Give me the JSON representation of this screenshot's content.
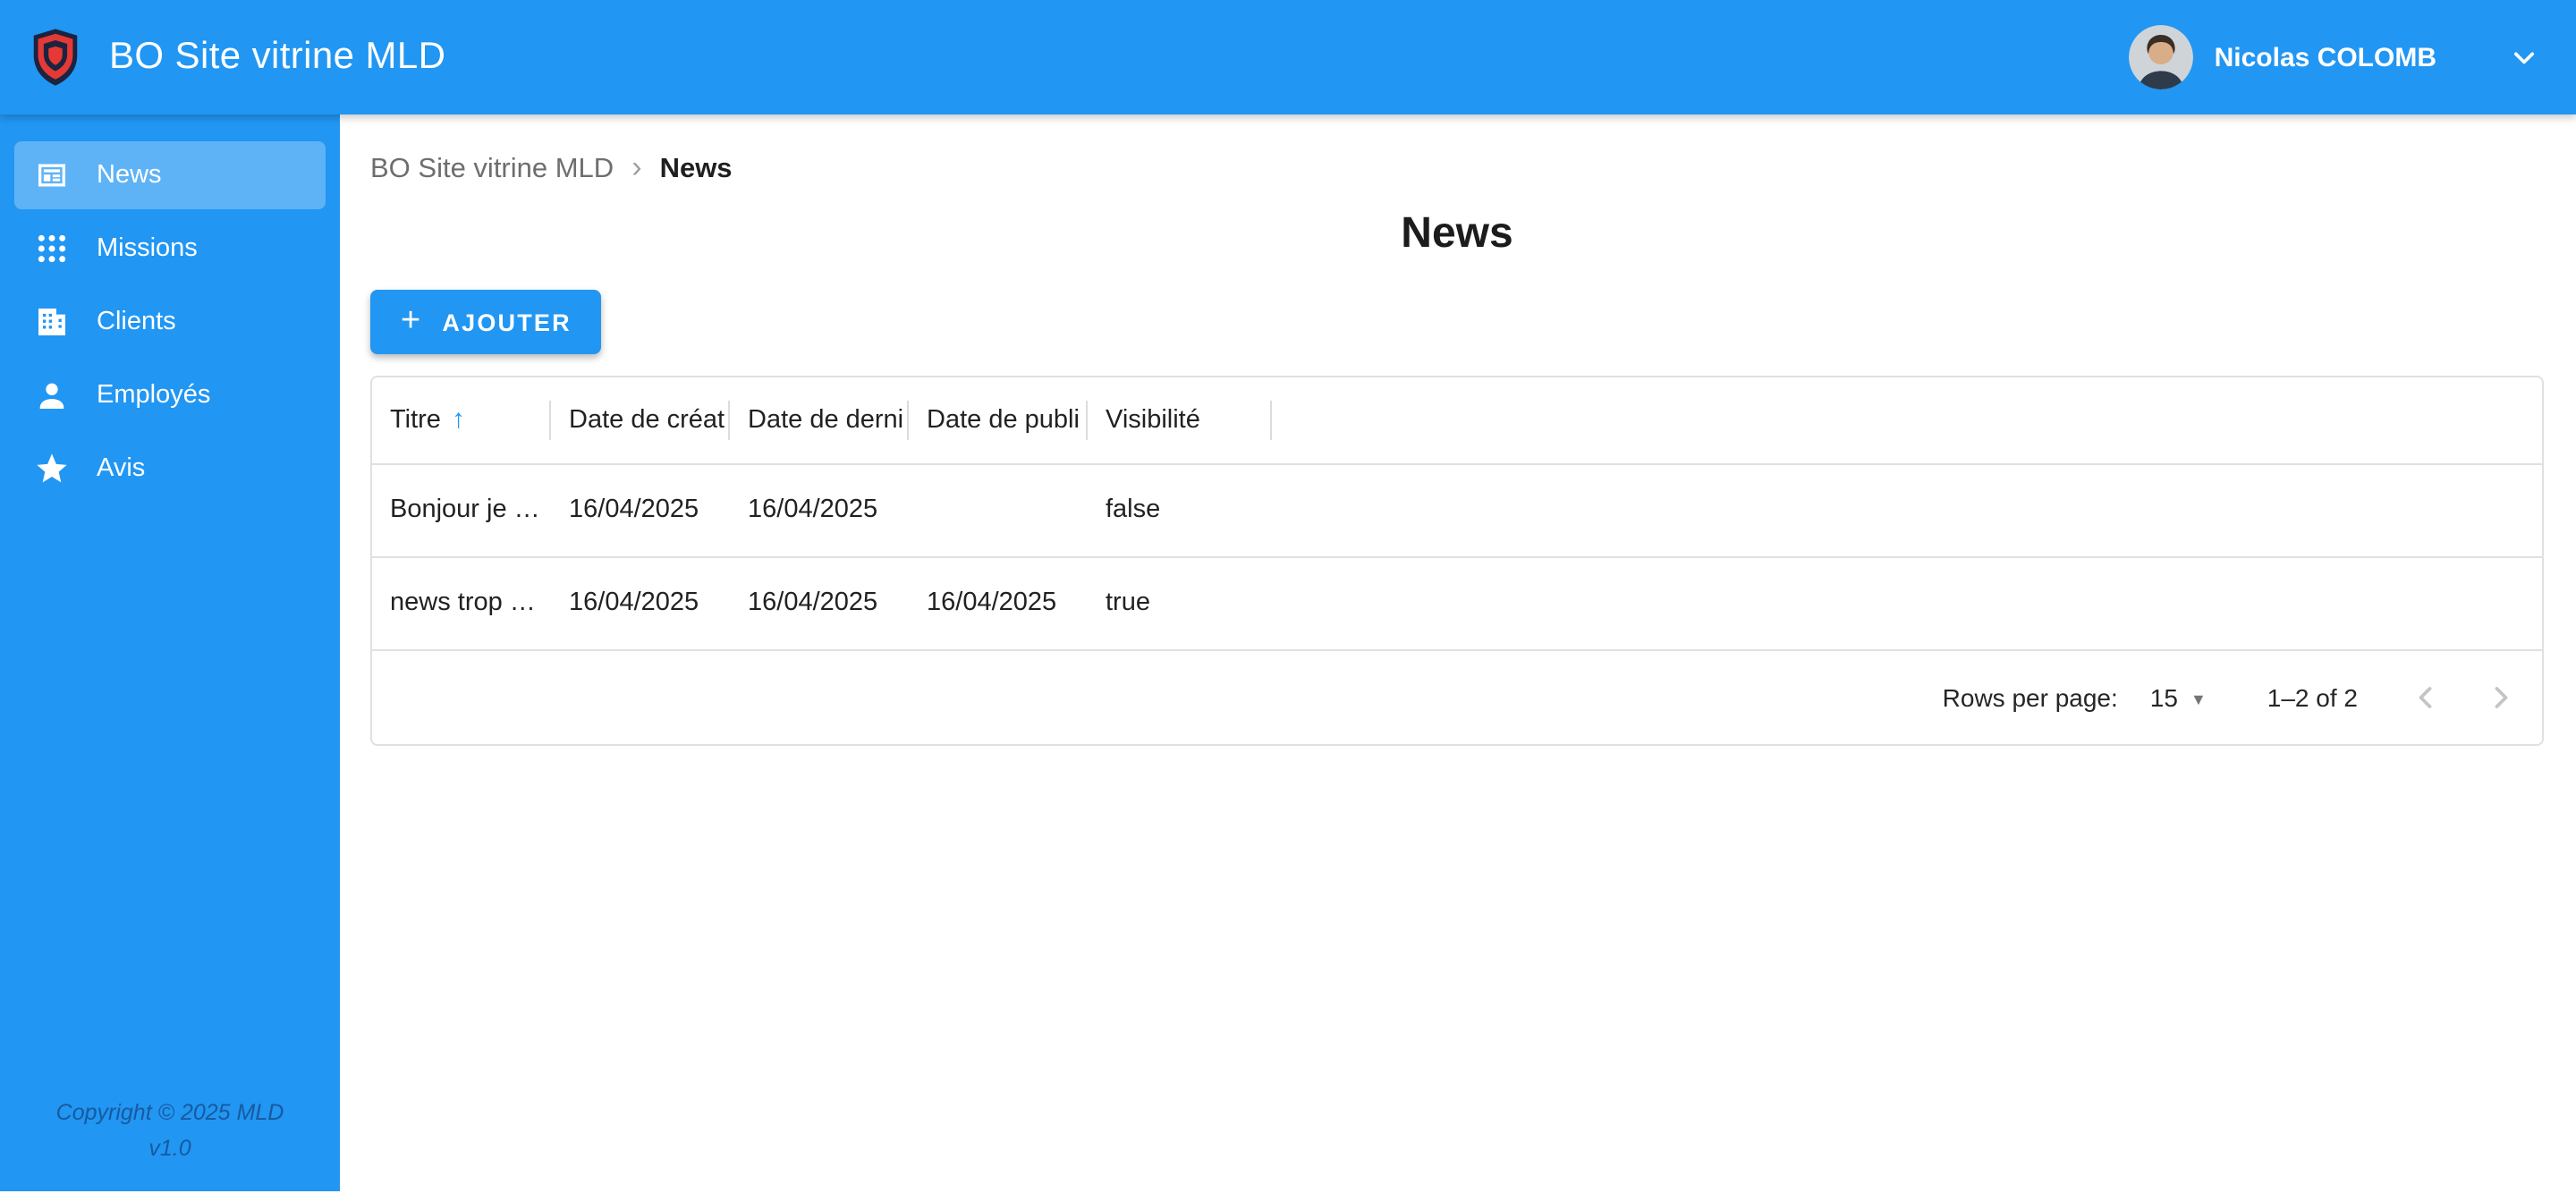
{
  "topbar": {
    "title": "BO Site vitrine MLD",
    "user_name": "Nicolas COLOMB"
  },
  "sidebar": {
    "items": [
      {
        "label": "News",
        "icon": "newspaper-icon",
        "active": true
      },
      {
        "label": "Missions",
        "icon": "grid-dots-icon",
        "active": false
      },
      {
        "label": "Clients",
        "icon": "building-icon",
        "active": false
      },
      {
        "label": "Employés",
        "icon": "person-icon",
        "active": false
      },
      {
        "label": "Avis",
        "icon": "star-icon",
        "active": false
      }
    ],
    "copyright_line1": "Copyright © 2025 MLD",
    "copyright_line2": "v1.0"
  },
  "breadcrumb": {
    "root": "BO Site vitrine MLD",
    "separator": "›",
    "current": "News"
  },
  "page": {
    "title": "News"
  },
  "toolbar": {
    "add_button_label": "AJOUTER",
    "add_button_icon": "+"
  },
  "table": {
    "headers": {
      "titre": "Titre",
      "date_creation": "Date de créat",
      "date_derniere": "Date de derni",
      "date_publication": "Date de publi",
      "visibilite": "Visibilité"
    },
    "sort": {
      "column": "Titre",
      "direction": "asc",
      "icon": "↑"
    },
    "rows": [
      {
        "titre": "Bonjour je …",
        "date_creation": "16/04/2025",
        "date_derniere": "16/04/2025",
        "date_publication": "",
        "visibilite": "false"
      },
      {
        "titre": "news trop …",
        "date_creation": "16/04/2025",
        "date_derniere": "16/04/2025",
        "date_publication": "16/04/2025",
        "visibilite": "true"
      }
    ]
  },
  "pagination": {
    "rows_per_page_label": "Rows per page:",
    "rows_per_page_value": "15",
    "select_caret": "▼",
    "range_text": "1–2 of 2"
  },
  "colors": {
    "primary": "#2196f3",
    "border": "#e0e0e0",
    "breadcrumb_gray": "#6e6e6e"
  }
}
